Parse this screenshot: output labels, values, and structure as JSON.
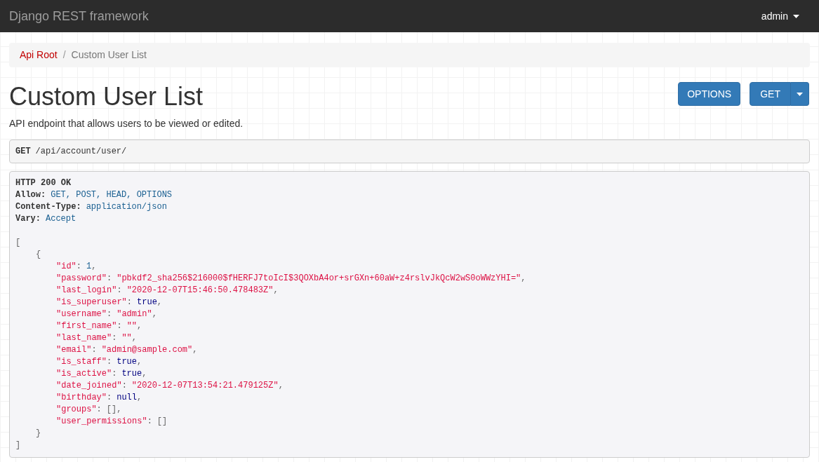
{
  "navbar": {
    "brand": "Django REST framework",
    "user_menu": "admin"
  },
  "breadcrumb_separator": "/",
  "breadcrumb": [
    {
      "label": "Api Root",
      "selected": false
    },
    {
      "label": "Custom User List",
      "selected": true
    }
  ],
  "title": "Custom User List",
  "buttons": {
    "options": "OPTIONS",
    "get": "GET"
  },
  "description": "API endpoint that allows users to be viewed or edited.",
  "request": {
    "method": "GET",
    "path": "/api/account/user/"
  },
  "response": {
    "status": "HTTP 200 OK",
    "headers": [
      {
        "name": "Allow:",
        "value": "GET, POST, HEAD, OPTIONS"
      },
      {
        "name": "Content-Type:",
        "value": "application/json"
      },
      {
        "name": "Vary:",
        "value": "Accept"
      }
    ],
    "body": {
      "open": "[",
      "close": "]",
      "items": [
        {
          "open": "{",
          "close": "}",
          "fields": [
            {
              "key": "\"id\"",
              "colon": ":",
              "value": "1",
              "kind": "number",
              "comma": ","
            },
            {
              "key": "\"password\"",
              "colon": ":",
              "value": "\"pbkdf2_sha256$216000$fHERFJ7toIcI$3QOXbA4or+srGXn+60aW+z4rslvJkQcW2wS0oWWzYHI=\"",
              "kind": "string",
              "comma": ","
            },
            {
              "key": "\"last_login\"",
              "colon": ":",
              "value": "\"2020-12-07T15:46:50.478483Z\"",
              "kind": "string",
              "comma": ","
            },
            {
              "key": "\"is_superuser\"",
              "colon": ":",
              "value": "true",
              "kind": "literal",
              "comma": ","
            },
            {
              "key": "\"username\"",
              "colon": ":",
              "value": "\"admin\"",
              "kind": "string",
              "comma": ","
            },
            {
              "key": "\"first_name\"",
              "colon": ":",
              "value": "\"\"",
              "kind": "string",
              "comma": ","
            },
            {
              "key": "\"last_name\"",
              "colon": ":",
              "value": "\"\"",
              "kind": "string",
              "comma": ","
            },
            {
              "key": "\"email\"",
              "colon": ":",
              "value": "\"admin@sample.com\"",
              "kind": "string",
              "comma": ","
            },
            {
              "key": "\"is_staff\"",
              "colon": ":",
              "value": "true",
              "kind": "literal",
              "comma": ","
            },
            {
              "key": "\"is_active\"",
              "colon": ":",
              "value": "true",
              "kind": "literal",
              "comma": ","
            },
            {
              "key": "\"date_joined\"",
              "colon": ":",
              "value": "\"2020-12-07T13:54:21.479125Z\"",
              "kind": "string",
              "comma": ","
            },
            {
              "key": "\"birthday\"",
              "colon": ":",
              "value": "null",
              "kind": "literal",
              "comma": ","
            },
            {
              "key": "\"groups\"",
              "colon": ":",
              "value": "[]",
              "kind": "punct",
              "comma": ","
            },
            {
              "key": "\"user_permissions\"",
              "colon": ":",
              "value": "[]",
              "kind": "punct"
            }
          ]
        }
      ]
    }
  }
}
